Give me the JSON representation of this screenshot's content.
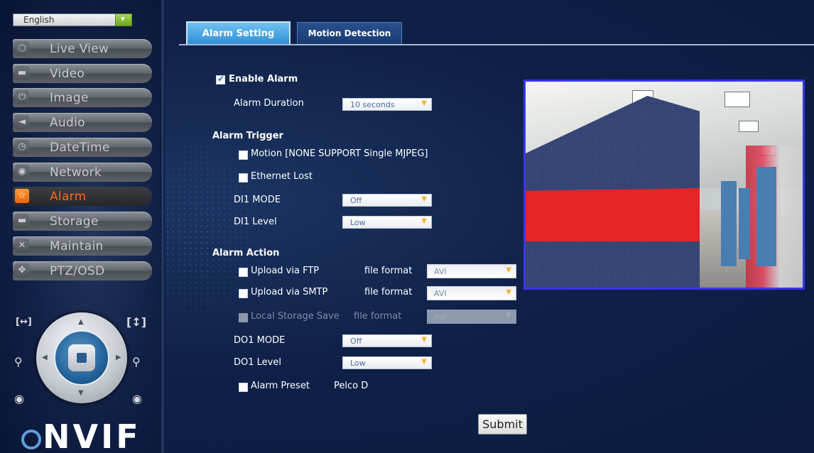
{
  "sidebar": {
    "language": "English",
    "items": [
      {
        "label": "Live View",
        "icon": "chat-bubble-icon",
        "active": false
      },
      {
        "label": "Video",
        "icon": "video-icon",
        "active": false
      },
      {
        "label": "Image",
        "icon": "power-icon",
        "active": false
      },
      {
        "label": "Audio",
        "icon": "speaker-icon",
        "active": false
      },
      {
        "label": "DateTime",
        "icon": "clock-icon",
        "active": false
      },
      {
        "label": "Network",
        "icon": "globe-icon",
        "active": false
      },
      {
        "label": "Alarm",
        "icon": "star-icon",
        "active": true
      },
      {
        "label": "Storage",
        "icon": "storage-icon",
        "active": false
      },
      {
        "label": "Maintain",
        "icon": "tools-icon",
        "active": false
      },
      {
        "label": "PTZ/OSD",
        "icon": "move-icon",
        "active": false
      }
    ],
    "ptz": {
      "zoom_out_symbol": "[↔]",
      "zoom_in_symbol": "[↕]"
    },
    "logo": "NVIF"
  },
  "tabs": {
    "alarm_setting": "Alarm Setting",
    "motion_detection": "Motion Detection"
  },
  "form": {
    "enable_alarm": {
      "label": "Enable Alarm",
      "checked": true
    },
    "alarm_duration": {
      "label": "Alarm Duration",
      "value": "10 seconds"
    },
    "alarm_trigger": {
      "heading": "Alarm Trigger",
      "motion": {
        "label": "Motion [NONE SUPPORT Single MJPEG]",
        "checked": false
      },
      "ethernet_lost": {
        "label": "Ethernet Lost",
        "checked": false
      },
      "di1_mode": {
        "label": "DI1 MODE",
        "value": "Off"
      },
      "di1_level": {
        "label": "DI1 Level",
        "value": "Low"
      }
    },
    "alarm_action": {
      "heading": "Alarm Action",
      "ftp": {
        "label": "Upload via FTP",
        "format_label": "file format",
        "format": "AVI",
        "checked": false
      },
      "smtp": {
        "label": "Upload via SMTP",
        "format_label": "file format",
        "format": "AVI",
        "checked": false
      },
      "local": {
        "label": "Local Storage Save",
        "format_label": "file format",
        "format": "AVI",
        "checked": false,
        "disabled": true
      },
      "do1_mode": {
        "label": "DO1 MODE",
        "value": "Off"
      },
      "do1_level": {
        "label": "DO1 Level",
        "value": "Low"
      },
      "preset": {
        "label": "Alarm Preset",
        "protocol": "Pelco D",
        "checked": false
      }
    },
    "submit": "Submit"
  },
  "colors": {
    "accent_active": "#ff6a1a",
    "tab_active": "#2e8fd6",
    "preview_border": "#3a35e8"
  }
}
